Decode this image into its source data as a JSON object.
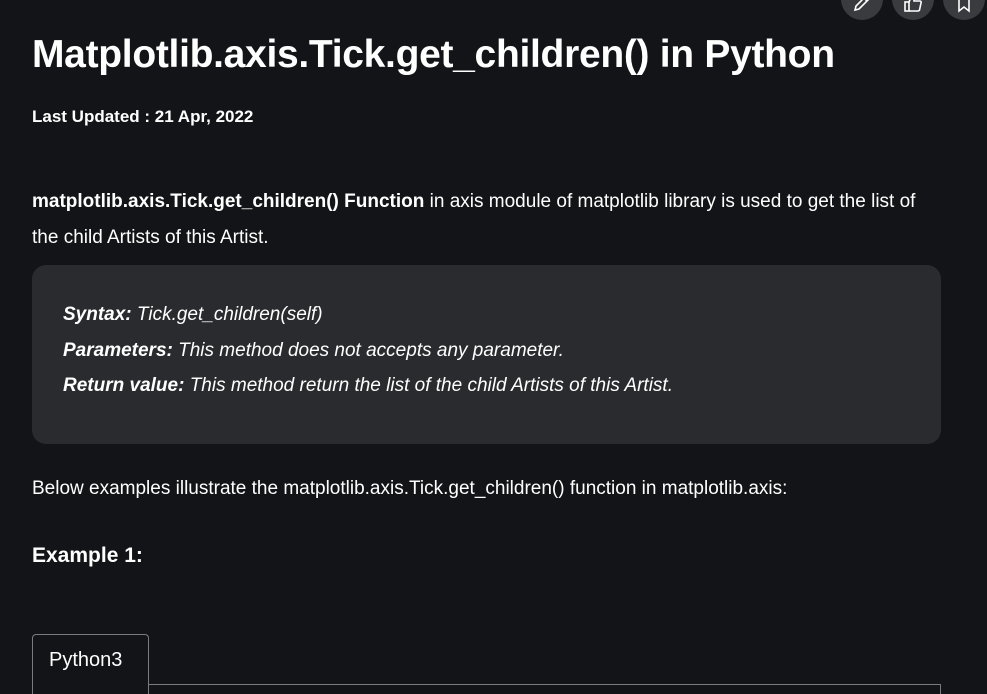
{
  "header": {
    "title": "Matplotlib.axis.Tick.get_children() in Python",
    "updated": "Last Updated : 21 Apr, 2022"
  },
  "actions": {
    "edit_icon": "pencil-icon",
    "like_icon": "thumbs-up-icon",
    "bookmark_icon": "bookmark-icon"
  },
  "intro": {
    "bold": "matplotlib.axis.Tick.get_children() Function",
    "text": " in axis module of matplotlib library is used to get the list of the child Artists of this Artist."
  },
  "syntax_box": {
    "syntax_label": "Syntax:",
    "syntax_value": " Tick.get_children(self)",
    "params_label": "Parameters:",
    "params_value": " This method does not accepts any parameter.",
    "return_label": "Return value:",
    "return_value": " This method return the list of the child Artists of this Artist."
  },
  "below_text": "Below examples illustrate the matplotlib.axis.Tick.get_children() function in matplotlib.axis:",
  "example_heading": "Example 1:",
  "code_tab_label": "Python3",
  "colors": {
    "background": "#131417",
    "box": "#2a2b2e",
    "text": "#ffffff"
  }
}
